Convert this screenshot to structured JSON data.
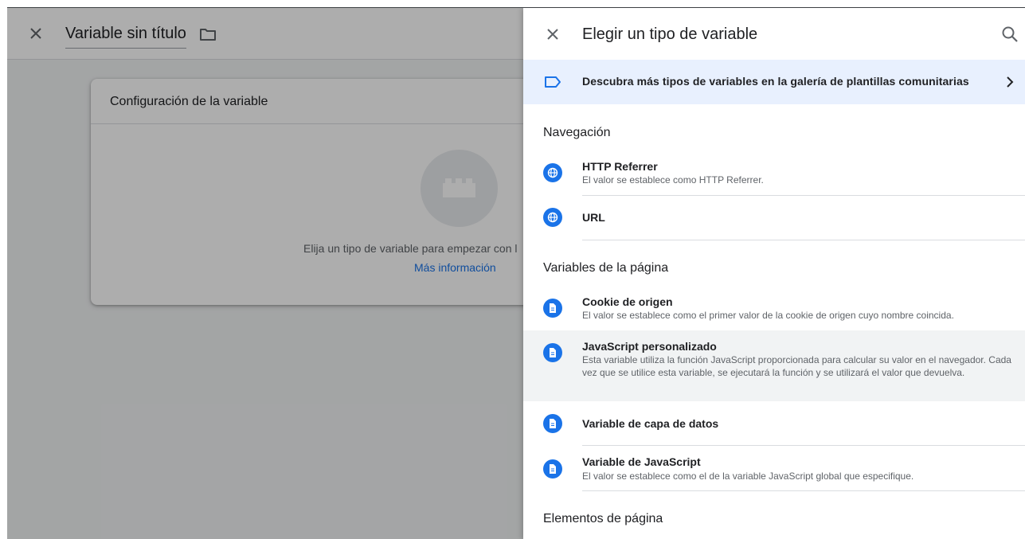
{
  "editor": {
    "title": "Variable sin título",
    "card": {
      "title": "Configuración de la variable",
      "hint": "Elija un tipo de variable para empezar con l",
      "link": "Más información"
    }
  },
  "panel": {
    "title": "Elegir un tipo de variable",
    "banner": "Descubra más tipos de variables en la galería de plantillas comunitarias",
    "sections": [
      {
        "title": "Navegación",
        "items": [
          {
            "name": "HTTP Referrer",
            "desc": "El valor se establece como HTTP Referrer.",
            "icon": "globe-icon"
          },
          {
            "name": "URL",
            "desc": "",
            "icon": "globe-icon"
          }
        ]
      },
      {
        "title": "Variables de la página",
        "items": [
          {
            "name": "Cookie de origen",
            "desc": "El valor se establece como el primer valor de la cookie de origen cuyo nombre coincida.",
            "icon": "document-icon"
          },
          {
            "name": "JavaScript personalizado",
            "desc": "Esta variable utiliza la función JavaScript proporcionada para calcular su valor en el navegador. Cada vez que se utilice esta variable, se ejecutará la función y se utilizará el valor que devuelva.",
            "icon": "document-icon"
          },
          {
            "name": "Variable de capa de datos",
            "desc": "",
            "icon": "document-icon"
          },
          {
            "name": "Variable de JavaScript",
            "desc": "El valor se establece como el de la variable JavaScript global que especifique.",
            "icon": "document-icon"
          }
        ]
      },
      {
        "title": "Elementos de página",
        "items": []
      }
    ]
  },
  "colors": {
    "accent": "#1a73e8",
    "banner_bg": "#e8f0fe",
    "highlight_bg": "#f1f3f4"
  }
}
